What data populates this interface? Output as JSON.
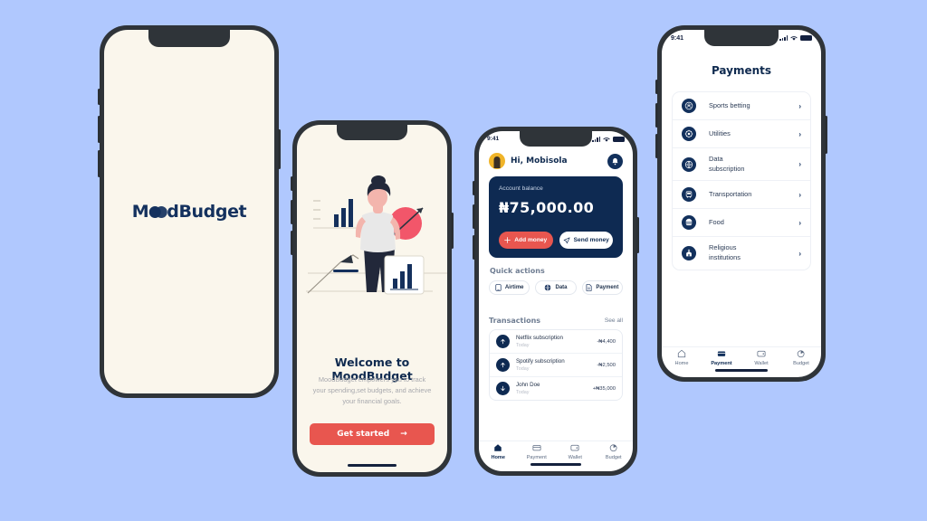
{
  "theme": {
    "background": "#b0c8fe",
    "cream": "#faf6ec",
    "navy": "#0e2a52",
    "red": "#e8564f",
    "frame": "#2f3439",
    "gold": "#f0b429"
  },
  "splash_phone": {
    "brand_name": "MoodBudget",
    "brand_prefix": "M",
    "brand_suffix": "dBudget"
  },
  "onboarding_phone": {
    "title": "Welcome to MoodBudget",
    "description": "MoodBudget  empowers you to  track your spending,set budgets, and achieve your financial goals.",
    "cta_label": "Get started",
    "cta_arrow": "→",
    "illustration_name": "woman-with-charts-illustration"
  },
  "home_phone": {
    "status": {
      "time": "9:41",
      "signal_icon": "signal-icon",
      "wifi_icon": "wifi-icon",
      "battery_icon": "battery-icon"
    },
    "greeting": "Hi, Mobisola",
    "avatar_name": "user-avatar",
    "notification_icon": "bell-icon",
    "balance": {
      "label": "Account balance",
      "amount": "₦75,000.00",
      "add_label": "Add money",
      "add_icon": "plus-icon",
      "send_label": "Send money",
      "send_icon": "paper-plane-icon"
    },
    "quick_actions_title": "Quick actions",
    "quick_actions": [
      {
        "label": "Airtime",
        "icon": "phone-icon"
      },
      {
        "label": "Data",
        "icon": "globe-icon"
      },
      {
        "label": "Payment",
        "icon": "document-icon"
      }
    ],
    "transactions_title": "Transactions",
    "see_all_label": "See all",
    "transactions": [
      {
        "name": "Netflix subscription",
        "when": "Today",
        "amount": "-₦4,400",
        "direction": "out"
      },
      {
        "name": "Spotify subscription",
        "when": "Today",
        "amount": "-₦2,500",
        "direction": "out"
      },
      {
        "name": "John Doe",
        "when": "Today",
        "amount": "+₦35,000",
        "direction": "in"
      }
    ],
    "tabs": [
      {
        "label": "Home",
        "icon": "home-icon",
        "active": true
      },
      {
        "label": "Payment",
        "icon": "card-icon",
        "active": false
      },
      {
        "label": "Wallet",
        "icon": "wallet-icon",
        "active": false
      },
      {
        "label": "Budget",
        "icon": "pie-chart-icon",
        "active": false
      }
    ]
  },
  "payments_phone": {
    "status": {
      "time": "9:41",
      "signal_icon": "signal-icon",
      "wifi_icon": "wifi-icon",
      "battery_icon": "battery-icon"
    },
    "title": "Payments",
    "items": [
      {
        "label": "Sports betting",
        "icon": "football-icon",
        "chevron": "›"
      },
      {
        "label": "Utilities",
        "icon": "gear-icon",
        "chevron": "›"
      },
      {
        "label": "Data\nsubscription",
        "icon": "globe-icon",
        "chevron": "›"
      },
      {
        "label": "Transportation",
        "icon": "bus-icon",
        "chevron": "›"
      },
      {
        "label": "Food",
        "icon": "burger-icon",
        "chevron": "›"
      },
      {
        "label": "Religious\ninstitutions",
        "icon": "church-icon",
        "chevron": "›"
      }
    ],
    "tabs": [
      {
        "label": "Home",
        "icon": "home-icon",
        "active": false
      },
      {
        "label": "Payment",
        "icon": "card-icon",
        "active": true
      },
      {
        "label": "Wallet",
        "icon": "wallet-icon",
        "active": false
      },
      {
        "label": "Budget",
        "icon": "pie-chart-icon",
        "active": false
      }
    ]
  }
}
